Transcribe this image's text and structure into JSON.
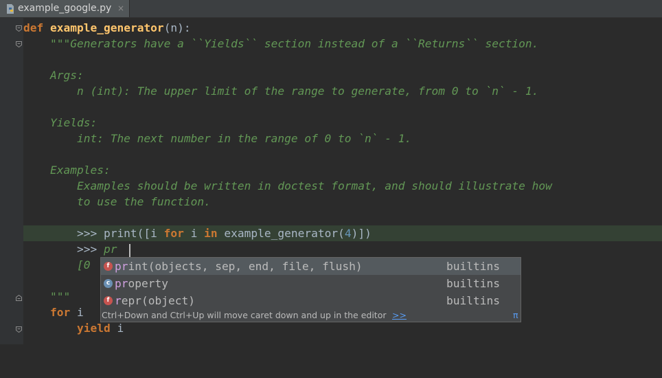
{
  "tab": {
    "filename": "example_google.py",
    "close": "×"
  },
  "code": {
    "l1_def": "def",
    "l1_name": "example_generator",
    "l1_args": "(n):",
    "l2": "    \"\"\"Generators have a ``Yields`` section instead of a ``Returns`` section.",
    "l4": "    Args:",
    "l5": "        n (int): The upper limit of the range to generate, from 0 to `n` - 1.",
    "l7": "    Yields:",
    "l8": "        int: The next number in the range of 0 to `n` - 1.",
    "l10": "    Examples:",
    "l11": "        Examples should be written in doctest format, and should illustrate how",
    "l12": "        to use the function.",
    "l14_a": "        >>> print([i ",
    "l14_for": "for",
    "l14_b": " i ",
    "l14_in": "in",
    "l14_c": " example_generator(",
    "l14_num": "4",
    "l14_d": ")])",
    "l15_prompt": "        >>> ",
    "l15_typed": "pr",
    "l16": "        [0",
    "l18": "    \"\"\"",
    "l19_for": "for",
    "l19_rest": " i",
    "l20_yield": "yield",
    "l20_rest": " i"
  },
  "completion": {
    "items": [
      {
        "badge": "f",
        "badge_color": "#c75450",
        "match": "pr",
        "rest": "int(objects, sep, end, file, flush)",
        "location": "builtins"
      },
      {
        "badge": "c",
        "badge_color": "#6a8fb3",
        "match": "pr",
        "rest": "operty",
        "location": "builtins"
      },
      {
        "badge": "f",
        "badge_color": "#c75450",
        "match": "r",
        "rest": "epr(object)",
        "location": "builtins"
      }
    ],
    "hint": "Ctrl+Down and Ctrl+Up will move caret down and up in the editor",
    "hint_link": ">>",
    "pi": "π"
  }
}
